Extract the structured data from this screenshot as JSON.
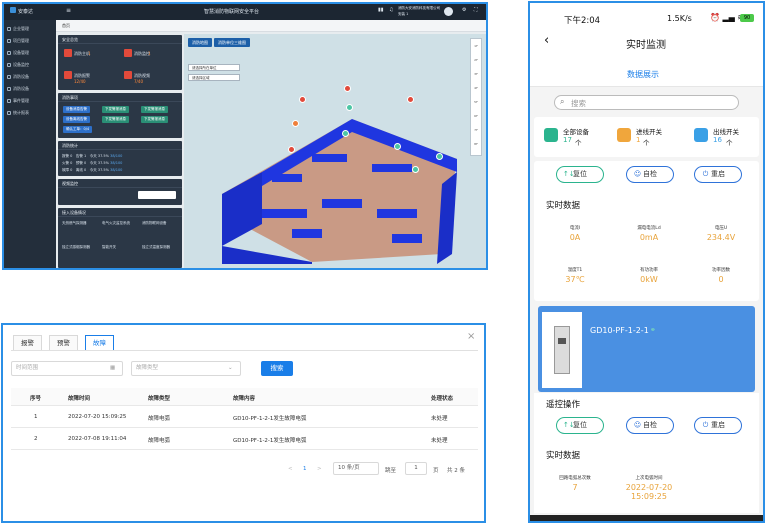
{
  "desktop": {
    "logo": "安泰达",
    "title": "智慧消防物联网安全平台",
    "header_text": "消防大安消防科技有限公司",
    "header_sub": "安装 1",
    "breadcrumb": "首页",
    "sidebar": [
      "企业管理",
      "项目管理",
      "设备管理",
      "设备监控",
      "消防设备",
      "消防设备",
      "事件管理",
      "统计报表"
    ],
    "map_buttons": [
      "消防地图",
      "消防单位三维图"
    ],
    "map_selects": [
      "请选择所在单位",
      "请选择区域"
    ],
    "map_tools": [
      "1F",
      "2F",
      "3F",
      "4F",
      "5F",
      "6F",
      "7F",
      "8F"
    ],
    "panel_titles": [
      "安全总览",
      "消防事项",
      "消防统计",
      "视频监控",
      "接入设备情况"
    ],
    "stat_labels": [
      "消防主机",
      "消防监控",
      "消防报警",
      "消防视频"
    ],
    "stat_values": [
      "1",
      "1",
      "12/40",
      "7/40"
    ],
    "items_labels": [
      "设备消息告警",
      "下发警报消息",
      "下发警报消息",
      "设备离线告警",
      "下发警报消息",
      "下发警报消息",
      "确认工单：0/4"
    ],
    "stats_rows": [
      [
        "报警",
        "0",
        "告警",
        "1",
        "今天",
        "37.5%",
        "38/100"
      ],
      [
        "火警",
        "0",
        "预警",
        "0",
        "今天",
        "37.5%",
        "38/100"
      ],
      [
        "故障",
        "0",
        "离线",
        "0",
        "今天",
        "37.5%",
        "38/100"
      ]
    ],
    "video_label": "视频监控",
    "equip_blocks": [
      "天然燃气探测器",
      "电气火灾监控系统",
      "消防物联网设备",
      "独立式感烟探测器",
      "智能开关",
      "独立式温度探测器"
    ],
    "map_legend": "图例"
  },
  "mobile": {
    "time": "下午2:04",
    "status": "1.5K/s",
    "battery": "90",
    "nav_title": "实时监测",
    "tab": "数据展示",
    "search_placeholder": "搜索",
    "summary": [
      {
        "label": "全部设备",
        "count": "17",
        "unit": "个",
        "color": "#2bb48e"
      },
      {
        "label": "进线开关",
        "count": "1",
        "unit": "个",
        "color": "#f0a63c"
      },
      {
        "label": "出线开关",
        "count": "16",
        "unit": "个",
        "color": "#3aa0e6"
      }
    ],
    "actions": [
      {
        "label": "复位",
        "icon": "↑↓",
        "color": "#2bb48e"
      },
      {
        "label": "自检",
        "icon": "☺",
        "color": "#2f73d9"
      },
      {
        "label": "重启",
        "icon": "⏻",
        "color": "#2f73d9"
      }
    ],
    "section_realtime": "实时数据",
    "realtime_values": [
      {
        "label": "电流I",
        "value": "0A"
      },
      {
        "label": "漏电电流Ld",
        "value": "0mA"
      },
      {
        "label": "电压U",
        "value": "234.4V"
      },
      {
        "label": "温度T1",
        "value": "37℃"
      },
      {
        "label": "有功功率",
        "value": "0kW"
      },
      {
        "label": "功率因数",
        "value": "0"
      }
    ],
    "device_name": "GD10-PF-1-2-1",
    "section_remote": "遥控操作",
    "section_realtime2": "实时数据",
    "realtime2": [
      {
        "label": "回路电弧总次数",
        "value": "7"
      },
      {
        "label": "上次电弧时间",
        "value": "2022-07-20 15:09:25"
      }
    ],
    "realtime2_time_line1": "2022-07-20",
    "realtime2_time_line2": "15:09:25"
  },
  "faults": {
    "tabs": [
      "报警",
      "预警",
      "故障"
    ],
    "date_placeholder": "时间范围",
    "type_placeholder": "故障类型",
    "search_button": "搜索",
    "columns": [
      "序号",
      "故障时间",
      "故障类型",
      "故障内容",
      "处理状态"
    ],
    "rows": [
      [
        "1",
        "2022-07-20 15:09:25",
        "故障电弧",
        "GD10-PF-1-2-1发生故障电弧",
        "未处理"
      ],
      [
        "2",
        "2022-07-08 19:11:04",
        "故障电弧",
        "GD10-PF-1-2-1发生故障电弧",
        "未处理"
      ]
    ],
    "pager": {
      "prev": "<",
      "current": "1",
      "next": ">",
      "size": "10 条/页",
      "jump_label": "跳至",
      "jump_value": "1",
      "page_suffix": "页",
      "total": "共 2 条"
    }
  }
}
